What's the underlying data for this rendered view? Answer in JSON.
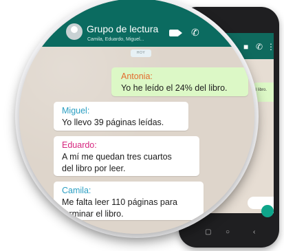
{
  "chat": {
    "group_title": "Grupo de lectura",
    "members": "Camila, Eduardo, Miguel...",
    "day_label": "HOY",
    "header_icons": [
      "video-call-icon",
      "phone-call-icon"
    ],
    "messages": [
      {
        "sender": "Antonia:",
        "text": "Yo he leído el 24% del libro.",
        "direction": "outgoing",
        "sender_color": "#e36b2d"
      },
      {
        "sender": "Miguel:",
        "text": "Yo llevo 39 páginas leídas.",
        "direction": "incoming",
        "sender_color": "#2a9ec2"
      },
      {
        "sender": "Eduardo:",
        "line1": "A mí me quedan tres cuartos",
        "line2": "del libro por leer.",
        "direction": "incoming",
        "sender_color": "#d6257e"
      },
      {
        "sender": "Camila:",
        "line1": "Me falta leer 110 páginas para",
        "line2": "terminar el libro.",
        "direction": "incoming",
        "sender_color": "#2a9ec2"
      }
    ]
  },
  "background_phone": {
    "bubble_fragment": "l libro.",
    "header_icons": [
      "video-call-icon",
      "phone-call-icon",
      "more-options-icon"
    ],
    "nav_icons": [
      "recent-apps-icon",
      "home-icon",
      "back-icon"
    ],
    "mic_icon": "microphone-icon"
  },
  "colors": {
    "header_green": "#0b6b60",
    "outgoing_bubble": "#dcf8c6",
    "incoming_bubble": "#ffffff",
    "chat_background": "#ded5cb"
  }
}
